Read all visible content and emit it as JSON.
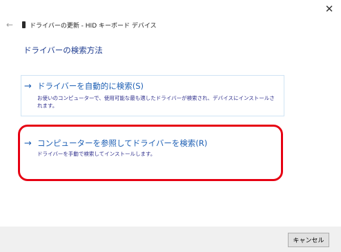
{
  "window": {
    "title": "ドライバーの更新 - HID キーボード デバイス",
    "close_glyph": "✕",
    "back_glyph": "←"
  },
  "heading": "ドライバーの検索方法",
  "options": [
    {
      "arrow_glyph": "→",
      "label": "ドライバーを自動的に検索(S)",
      "description": "お使いのコンピューターで、使用可能な最も適したドライバーが検索され、デバイスにインストールされます。"
    },
    {
      "arrow_glyph": "→",
      "label": "コンピューターを参照してドライバーを検索(R)",
      "description": "ドライバーを手動で検索してインストールします。"
    }
  ],
  "footer": {
    "cancel_label": "キャンセル"
  },
  "colors": {
    "link_blue": "#1d5fb4",
    "heading_blue": "#1d3b8f",
    "highlight_red": "#e60012",
    "footer_bg": "#f0f0f0"
  }
}
